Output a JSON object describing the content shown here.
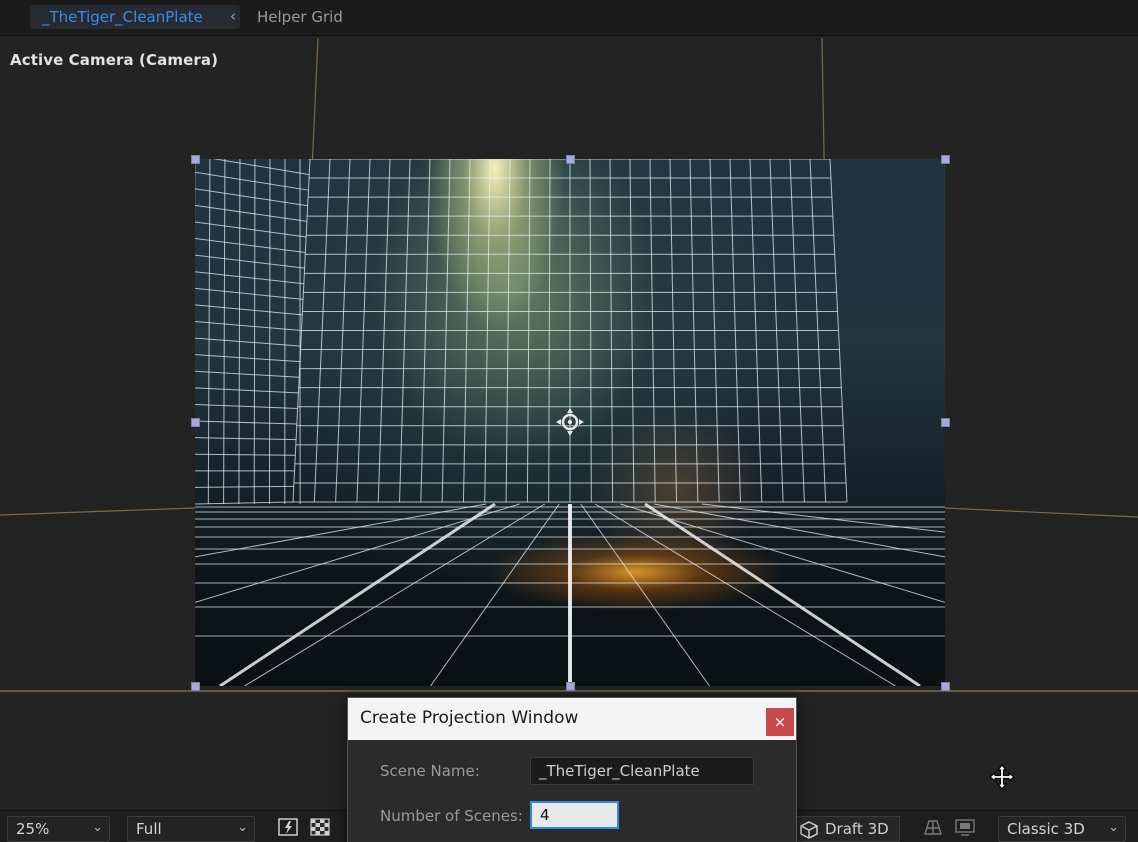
{
  "tabs": {
    "active": "_TheTiger_CleanPlate",
    "chevron": "‹",
    "other": "Helper Grid"
  },
  "viewer": {
    "camera_label": "Active Camera (Camera)"
  },
  "dialog": {
    "title": "Create Projection Window",
    "close": "×",
    "scene_name_label": "Scene Name:",
    "scene_name_value": "_TheTiger_CleanPlate",
    "num_scenes_label": "Number of Scenes:",
    "num_scenes_value": "4"
  },
  "toolbar": {
    "zoom": "25%",
    "resolution": "Full",
    "draft3d": "Draft 3D",
    "renderer": "Classic 3D",
    "dropdown_arrow": "⌄"
  },
  "colors": {
    "accent": "#2d8ce0",
    "tab_text": "#3d8ee0",
    "close_button": "#c94a4a",
    "handle": "#a9a9d6"
  },
  "icons": [
    "chevron-left-icon",
    "transform-anchor-icon",
    "move-cursor-icon",
    "fast-preview-icon",
    "transparency-grid-icon",
    "cube-icon",
    "view-layout-icon",
    "view-options-icon",
    "chevron-down-icon"
  ]
}
